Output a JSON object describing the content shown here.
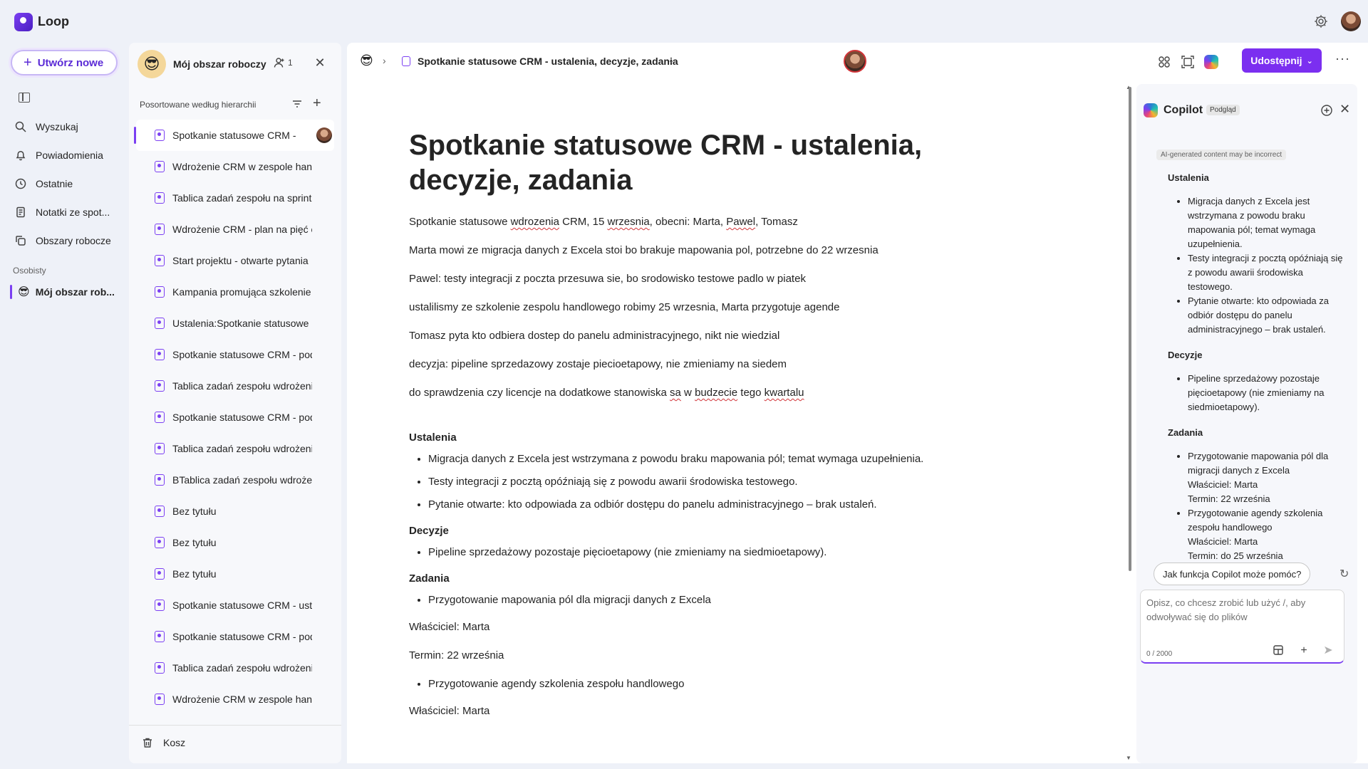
{
  "app": {
    "title": "Loop"
  },
  "nav": {
    "create_label": "Utwórz nowe",
    "items": [
      {
        "label": "Wyszukaj",
        "icon": "search-icon"
      },
      {
        "label": "Powiadomienia",
        "icon": "bell-icon"
      },
      {
        "label": "Ostatnie",
        "icon": "clock-icon"
      },
      {
        "label": "Notatki ze spot...",
        "icon": "notes-icon"
      },
      {
        "label": "Obszary robocze",
        "icon": "workspaces-icon"
      }
    ],
    "section_label": "Osobisty",
    "active_workspace": "Mój obszar rob..."
  },
  "workspace": {
    "title": "Mój obszar roboczy",
    "members_count": "1",
    "sort_label": "Posortowane według hierarchii",
    "pages": [
      "Spotkanie statusowe CRM -",
      "Wdrożenie CRM w zespole handlowym",
      "Tablica zadań zespołu na sprint",
      "Wdrożenie CRM - plan na pięć etapów",
      "Start projektu - otwarte pytania",
      "Kampania promująca szkolenie",
      "Ustalenia:Spotkanie statusowe CRM",
      "Spotkanie statusowe CRM - podsumowanie",
      "Tablica zadań zespołu wdrożeniowego",
      "Spotkanie statusowe CRM - podsumowanie",
      "Tablica zadań zespołu wdrożeniowego",
      "BTablica zadań zespołu wdrożeniowego",
      "Bez tytułu",
      "Bez tytułu",
      "Bez tytułu",
      "Spotkanie statusowe CRM - ustalenia",
      "Spotkanie statusowe CRM - podsumowanie",
      "Tablica zadań zespołu wdrożeniowego",
      "Wdrożenie CRM w zespole handlowym"
    ],
    "trash_label": "Kosz"
  },
  "document": {
    "breadcrumb_title": "Spotkanie statusowe CRM - ustalenia, decyzje, zadania",
    "share_label": "Udostępnij",
    "title": "Spotkanie statusowe CRM - ustalenia, decyzje, zadania",
    "notes": [
      "Marta mowi ze migracja danych z Excela stoi bo brakuje mapowania pol, potrzebne do 22 wrzesnia",
      "Pawel: testy integracji z poczta przesuwa sie, bo srodowisko testowe padlo w piatek",
      "ustalilismy ze szkolenie zespolu handlowego robimy 25 wrzesnia, Marta przygotuje agende",
      "Tomasz pyta kto odbiera dostep do panelu administracyjnego, nikt nie wiedzial",
      "decyzja: pipeline sprzedazowy zostaje piecioetapowy, nie zmieniamy na siedem"
    ],
    "ustalenia_heading": "Ustalenia",
    "ustalenia": [
      "Migracja danych z Excela jest wstrzymana z powodu braku mapowania pól; temat wymaga uzupełnienia.",
      "Testy integracji z pocztą opóźniają się z powodu awarii środowiska testowego.",
      "Pytanie otwarte: kto odpowiada za odbiór dostępu do panelu administracyjnego – brak ustaleń."
    ],
    "decyzje_heading": "Decyzje",
    "decyzje": [
      "Pipeline sprzedażowy pozostaje pięcioetapowy (nie zmieniamy na siedmioetapowy)."
    ],
    "zadania_heading": "Zadania",
    "task1": "Przygotowanie mapowania pól dla migracji danych z Excela",
    "task1_owner": "Właściciel: Marta",
    "task1_due": "Termin: 22 września",
    "task2": "Przygotowanie agendy szkolenia zespołu handlowego",
    "task2_owner": "Właściciel: Marta"
  },
  "copilot": {
    "title": "Copilot",
    "badge": "Podgląd",
    "disclaimer": "AI-generated content may be incorrect",
    "ustalenia_heading": "Ustalenia",
    "ustalenia": [
      "Migracja danych z Excela jest wstrzymana z powodu braku mapowania pól; temat wymaga uzupełnienia.",
      "Testy integracji z pocztą opóźniają się z powodu awarii środowiska testowego.",
      "Pytanie otwarte: kto odpowiada za odbiór dostępu do panelu administracyjnego – brak ustaleń."
    ],
    "decyzje_heading": "Decyzje",
    "decyzje": [
      "Pipeline sprzedażowy pozostaje pięcioetapowy (nie zmieniamy na siedmioetapowy)."
    ],
    "zadania_heading": "Zadania",
    "zadania": [
      {
        "task": "Przygotowanie mapowania pól dla migracji danych z Excela",
        "owner": "Właściciel: Marta",
        "due": "Termin: 22 września"
      },
      {
        "task": "Przygotowanie agendy szkolenia zespołu handlowego",
        "owner": "Właściciel: Marta",
        "due": "Termin: do 25 września"
      }
    ],
    "prompt_chip": "Jak funkcja Copilot może pomóc?",
    "input_placeholder": "Opisz, co chcesz zrobić lub użyć /, aby odwoływać się do plików",
    "counter": "0 / 2000"
  },
  "colors": {
    "accent": "#7b2ff0",
    "background": "#eef1f8",
    "spellcheck": "#d13438"
  }
}
